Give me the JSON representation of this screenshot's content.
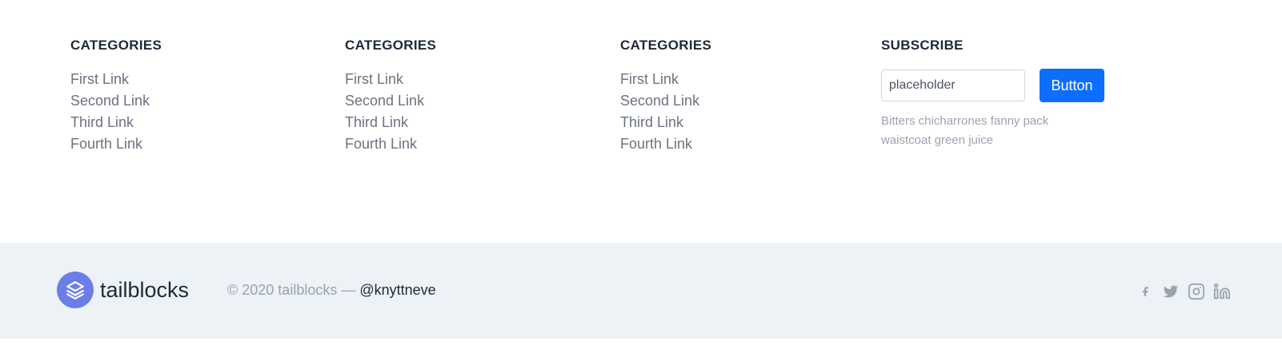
{
  "columns": [
    {
      "title": "CATEGORIES",
      "links": [
        "First Link",
        "Second Link",
        "Third Link",
        "Fourth Link"
      ]
    },
    {
      "title": "CATEGORIES",
      "links": [
        "First Link",
        "Second Link",
        "Third Link",
        "Fourth Link"
      ]
    },
    {
      "title": "CATEGORIES",
      "links": [
        "First Link",
        "Second Link",
        "Third Link",
        "Fourth Link"
      ]
    }
  ],
  "subscribe": {
    "title": "SUBSCRIBE",
    "input_placeholder": "placeholder",
    "button_label": "Button",
    "description": "Bitters chicharrones fanny pack waistcoat green juice"
  },
  "footer": {
    "brand_name": "tailblocks",
    "copyright_prefix": "© 2020 tailblocks —",
    "handle": "@knyttneve",
    "social_icons": [
      "facebook-icon",
      "twitter-icon",
      "instagram-icon",
      "linkedin-icon"
    ]
  },
  "colors": {
    "accent": "#0d6efd",
    "brand_logo": "#6b7ee8",
    "footer_bg": "#edf2f7",
    "icon_gray": "#9ca3af"
  }
}
